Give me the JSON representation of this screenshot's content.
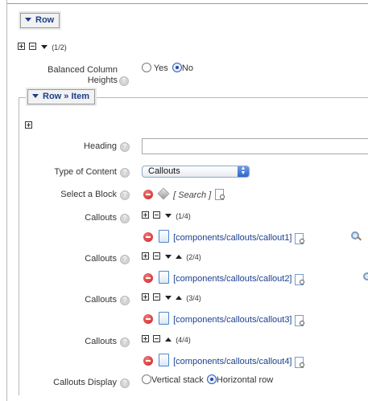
{
  "row_section": {
    "legend": "Row",
    "counter": "(1/2)",
    "balanced": {
      "label": "Balanced Column Heights",
      "options": [
        "Yes",
        "No"
      ],
      "selected": "No"
    }
  },
  "item_section": {
    "legend": "Row » Item",
    "heading": {
      "label": "Heading",
      "value": ""
    },
    "type_of_content": {
      "label": "Type of Content",
      "value": "Callouts"
    },
    "select_block": {
      "label": "Select a Block",
      "search_label": "[ Search ]"
    },
    "callouts": [
      {
        "label": "Callouts",
        "counter": "(1/4)",
        "path": "[components/callouts/callout1]"
      },
      {
        "label": "Callouts",
        "counter": "(2/4)",
        "path": "[components/callouts/callout2]"
      },
      {
        "label": "Callouts",
        "counter": "(3/4)",
        "path": "[components/callouts/callout3]"
      },
      {
        "label": "Callouts",
        "counter": "(4/4)",
        "path": "[components/callouts/callout4]"
      }
    ],
    "display": {
      "label": "Callouts Display",
      "options": [
        "Vertical stack",
        "Horizontal row"
      ],
      "selected": "Horizontal row"
    }
  }
}
